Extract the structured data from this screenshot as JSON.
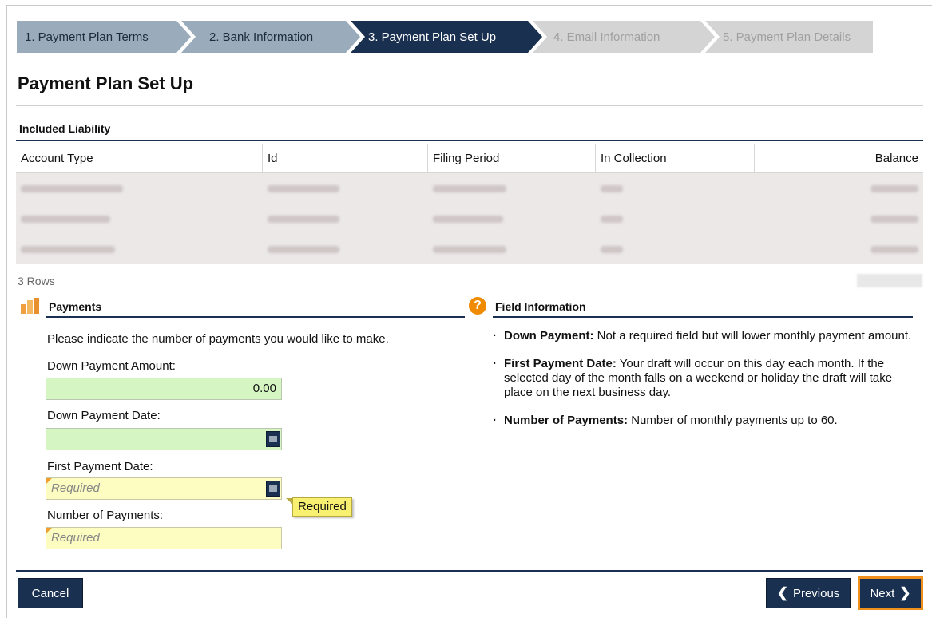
{
  "wizard": {
    "steps": [
      {
        "label": "1. Payment Plan Terms"
      },
      {
        "label": "2. Bank Information"
      },
      {
        "label": "3. Payment Plan Set Up"
      },
      {
        "label": "4. Email Information"
      },
      {
        "label": "5. Payment Plan Details"
      }
    ],
    "active_step": 3
  },
  "page": {
    "title": "Payment Plan Set Up"
  },
  "liability": {
    "section_label": "Included Liability",
    "columns": [
      "Account Type",
      "Id",
      "Filing Period",
      "In Collection",
      "Balance"
    ],
    "row_count_text": "3 Rows"
  },
  "payments": {
    "title": "Payments",
    "intro": "Please indicate the number of payments you would like to make.",
    "down_payment_amount_label": "Down Payment Amount:",
    "down_payment_amount_value": "0.00",
    "down_payment_date_label": "Down Payment Date:",
    "first_payment_date_label": "First Payment Date:",
    "first_payment_date_placeholder": "Required",
    "number_of_payments_label": "Number of Payments:",
    "number_of_payments_placeholder": "Required",
    "tooltip": "Required"
  },
  "field_info": {
    "title": "Field Information",
    "items": [
      {
        "term": "Down Payment:",
        "text": " Not a required field but will lower monthly payment amount."
      },
      {
        "term": "First Payment Date:",
        "text": " Your draft will occur on this day each month. If the selected day of the month falls on a weekend or holiday the draft will take place on the next business day."
      },
      {
        "term": "Number of Payments:",
        "text": " Number of monthly payments up to 60."
      }
    ]
  },
  "footer": {
    "cancel_label": "Cancel",
    "previous_label": "Previous",
    "next_label": "Next"
  },
  "colors": {
    "navy": "#1a3050",
    "step_done": "#9aabbb",
    "step_future": "#d4d4d4",
    "field_green": "#d5f5c2",
    "field_yellow": "#fdfdc2",
    "focus_orange": "#f0901c"
  },
  "icons": {
    "payments": "coins-icon",
    "field_info": "help-circle-icon",
    "calendar": "calendar-icon",
    "previous": "chevron-left-icon",
    "next": "chevron-right-icon"
  }
}
